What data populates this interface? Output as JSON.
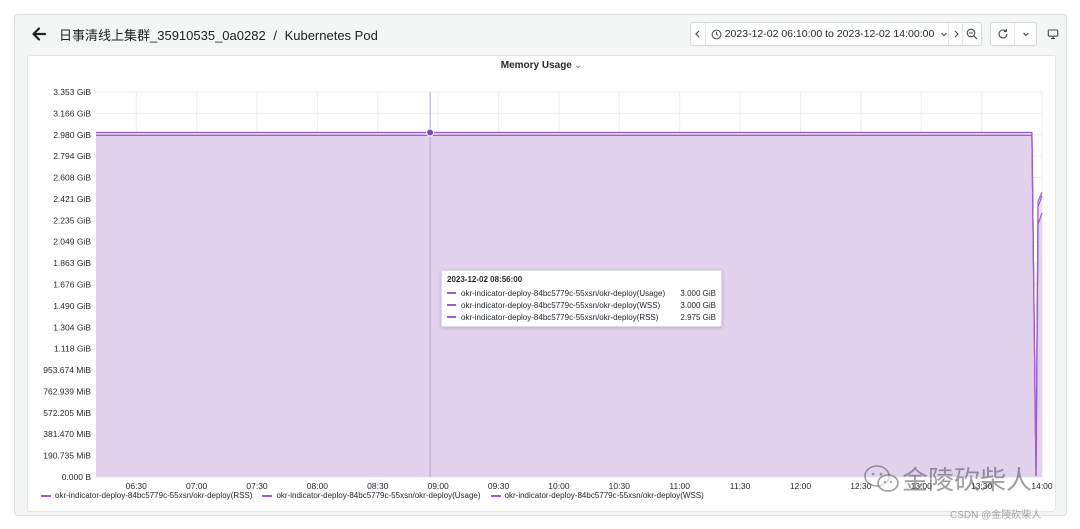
{
  "header": {
    "cluster": "日事清线上集群_35910535_0a0282",
    "separator": "/",
    "view": "Kubernetes Pod"
  },
  "toolbar": {
    "time_range": "2023-12-02 06:10:00 to 2023-12-02 14:00:00"
  },
  "panel": {
    "title": "Memory Usage"
  },
  "tooltip": {
    "time": "2023-12-02 08:56:00",
    "rows": [
      {
        "name": "okr-indicator-deploy-84bc5779c-55xsn/okr-deploy(Usage)",
        "value": "3.000 GiB"
      },
      {
        "name": "okr-indicator-deploy-84bc5779c-55xsn/okr-deploy(WSS)",
        "value": "3.000 GiB"
      },
      {
        "name": "okr-indicator-deploy-84bc5779c-55xsn/okr-deploy(RSS)",
        "value": "2.975 GiB"
      }
    ]
  },
  "legend": [
    "okr-indicator-deploy-84bc5779c-55xsn/okr-deploy(RSS)",
    "okr-indicator-deploy-84bc5779c-55xsn/okr-deploy(Usage)",
    "okr-indicator-deploy-84bc5779c-55xsn/okr-deploy(WSS)"
  ],
  "colors": {
    "series": "#9e5fc8",
    "fill": "#e2d0ee",
    "accent": "#7d4bb0"
  },
  "icons": [
    "back-arrow-icon",
    "chevron-left-icon",
    "clock-icon",
    "chevron-down-icon",
    "chevron-right-icon",
    "zoom-out-icon",
    "refresh-icon",
    "monitor-icon"
  ],
  "watermark": {
    "text": "金陵砍柴人",
    "csdn": "CSDN @金陵砍柴人"
  },
  "chart_data": {
    "type": "area",
    "title": "Memory Usage",
    "yticks": [
      "0.000 B",
      "190.735 MiB",
      "381.470 MiB",
      "572.205 MiB",
      "762.939 MiB",
      "953.674 MiB",
      "1.118 GiB",
      "1.304 GiB",
      "1.490 GiB",
      "1.676 GiB",
      "1.863 GiB",
      "2.049 GiB",
      "2.235 GiB",
      "2.421 GiB",
      "2.608 GiB",
      "2.794 GiB",
      "2.980 GiB",
      "3.166 GiB",
      "3.353 GiB"
    ],
    "xticks": [
      "06:30",
      "07:00",
      "07:30",
      "08:00",
      "08:30",
      "09:00",
      "09:30",
      "10:00",
      "10:30",
      "11:00",
      "11:30",
      "12:00",
      "12:30",
      "13:00",
      "13:30",
      "14:00"
    ],
    "x_range": [
      "06:10",
      "14:00"
    ],
    "ylim": [
      0,
      3.353
    ],
    "y_unit": "GiB",
    "grid": true,
    "legend_position": "bottom-left",
    "crosshair_time": "08:56",
    "series": [
      {
        "name": "okr-indicator-deploy-84bc5779c-55xsn/okr-deploy(RSS)",
        "x": [
          "06:10",
          "08:56",
          "13:55",
          "13:57",
          "13:58",
          "14:00"
        ],
        "values": [
          2.975,
          2.975,
          2.975,
          0.01,
          2.2,
          2.3
        ]
      },
      {
        "name": "okr-indicator-deploy-84bc5779c-55xsn/okr-deploy(Usage)",
        "x": [
          "06:10",
          "08:56",
          "13:55",
          "13:57",
          "13:58",
          "14:00"
        ],
        "values": [
          3.0,
          3.0,
          3.0,
          0.01,
          2.4,
          2.48
        ]
      },
      {
        "name": "okr-indicator-deploy-84bc5779c-55xsn/okr-deploy(WSS)",
        "x": [
          "06:10",
          "08:56",
          "13:55",
          "13:57",
          "13:58",
          "14:00"
        ],
        "values": [
          3.0,
          3.0,
          3.0,
          0.01,
          2.35,
          2.45
        ]
      }
    ]
  }
}
